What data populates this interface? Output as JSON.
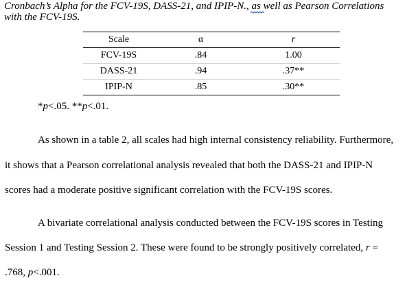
{
  "caption": {
    "line1_a": "Cronbach’s Alpha for the FCV-19S, DASS-21, and IPIP-",
    "line1_b": "N.",
    "line1_c": ", as well as Pearson Correlations",
    "line2": "with the FCV-19S."
  },
  "table": {
    "headers": [
      "Scale",
      "α",
      "r"
    ],
    "rows": [
      [
        "FCV-19S",
        ".84",
        "1.00"
      ],
      [
        "DASS-21",
        ".94",
        ".37**"
      ],
      [
        "IPIP-N",
        ".85",
        ".30**"
      ]
    ]
  },
  "note": {
    "p1_prefix": "*",
    "p1_var": "p",
    "p1_rest": "<.05. **",
    "p2_var": "p",
    "p2_rest": "<.01."
  },
  "paragraph1": {
    "line1": "As shown in a table 2, all scales had high internal consistency reliability. Furthermore,",
    "line2": "it shows that a Pearson correlational analysis revealed that both the DASS-21 and IPIP-N",
    "line3": "scores had a moderate positive significant correlation with the FCV-19S scores."
  },
  "paragraph2": {
    "line1": "A bivariate correlational analysis conducted between the FCV-19S scores in Testing",
    "line2_text": "Session 1 and Testing Session 2. These were found to be strongly positively correlated, ",
    "line2_var": "r",
    "line2_eq": " =",
    "line3_a": ".768, ",
    "line3_var": "p",
    "line3_b": "<.001."
  }
}
